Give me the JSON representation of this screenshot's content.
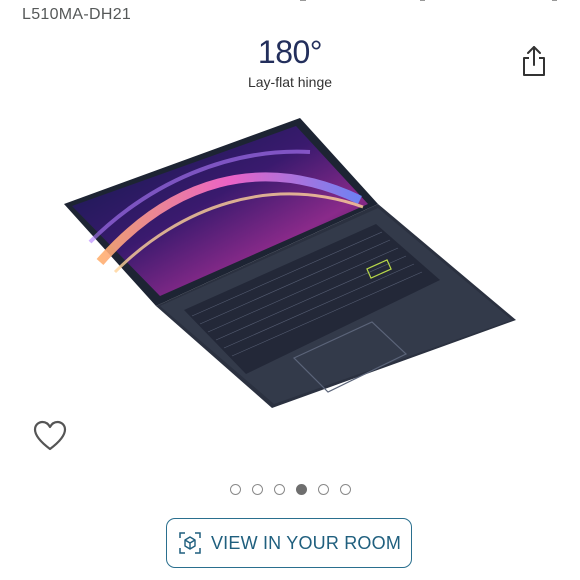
{
  "product": {
    "model": "L510MA-DH21"
  },
  "hero": {
    "degree": "180°",
    "caption": "Lay-flat hinge",
    "image_name": "laptop-image"
  },
  "actions": {
    "share_icon": "share-icon",
    "wishlist_icon": "heart-icon"
  },
  "carousel": {
    "count": 6,
    "active_index": 3
  },
  "ar": {
    "button_label": "VIEW IN YOUR ROOM",
    "icon": "ar-cube-icon"
  },
  "colors": {
    "accent": "#232f5c",
    "button_border": "#2a6f8e",
    "button_text": "#1f5f7e"
  }
}
